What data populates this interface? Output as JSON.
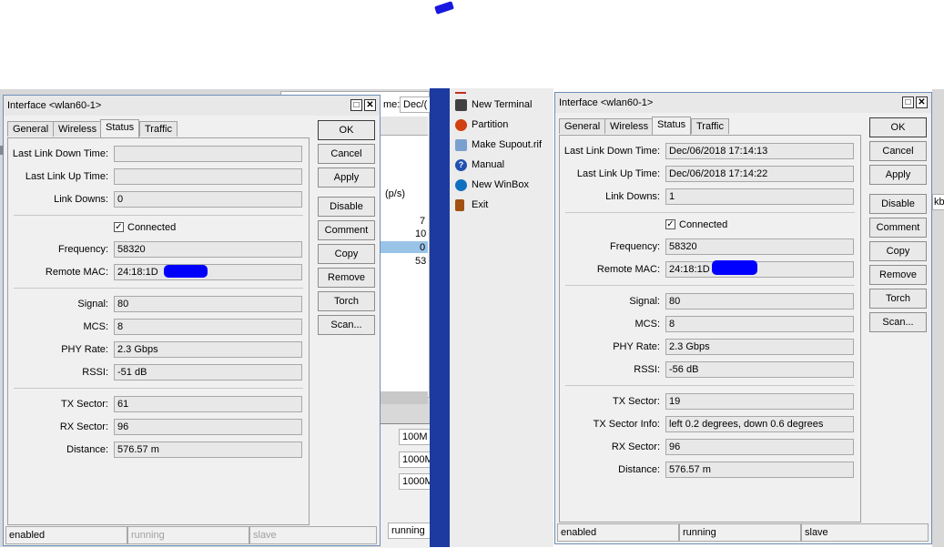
{
  "left_window": {
    "title": "Interface <wlan60-1>",
    "tabs": [
      "General",
      "Wireless",
      "Status",
      "Traffic"
    ],
    "active_tab": "Status",
    "fields": {
      "last_link_down_label": "Last Link Down Time:",
      "last_link_down": "",
      "last_link_up_label": "Last Link Up Time:",
      "last_link_up": "",
      "link_downs_label": "Link Downs:",
      "link_downs": "0",
      "connected_label": "Connected",
      "frequency_label": "Frequency:",
      "frequency": "58320",
      "remote_mac_label": "Remote MAC:",
      "remote_mac": "24:18:1D",
      "signal_label": "Signal:",
      "signal": "80",
      "mcs_label": "MCS:",
      "mcs": "8",
      "phy_rate_label": "PHY Rate:",
      "phy_rate": "2.3 Gbps",
      "rssi_label": "RSSI:",
      "rssi": "-51 dB",
      "tx_sector_label": "TX Sector:",
      "tx_sector": "61",
      "rx_sector_label": "RX Sector:",
      "rx_sector": "96",
      "distance_label": "Distance:",
      "distance": "576.57 m"
    },
    "buttons": [
      "OK",
      "Cancel",
      "Apply",
      "Disable",
      "Comment",
      "Copy",
      "Remove",
      "Torch",
      "Scan..."
    ],
    "status": [
      "enabled",
      "running",
      "slave"
    ]
  },
  "right_window": {
    "title": "Interface <wlan60-1>",
    "tabs": [
      "General",
      "Wireless",
      "Status",
      "Traffic"
    ],
    "active_tab": "Status",
    "fields": {
      "last_link_down_label": "Last Link Down Time:",
      "last_link_down": "Dec/06/2018 17:14:13",
      "last_link_up_label": "Last Link Up Time:",
      "last_link_up": "Dec/06/2018 17:14:22",
      "link_downs_label": "Link Downs:",
      "link_downs": "1",
      "connected_label": "Connected",
      "frequency_label": "Frequency:",
      "frequency": "58320",
      "remote_mac_label": "Remote MAC:",
      "remote_mac": "24:18:1D",
      "signal_label": "Signal:",
      "signal": "80",
      "mcs_label": "MCS:",
      "mcs": "8",
      "phy_rate_label": "PHY Rate:",
      "phy_rate": "2.3 Gbps",
      "rssi_label": "RSSI:",
      "rssi": "-56 dB",
      "tx_sector_label": "TX Sector:",
      "tx_sector": "19",
      "tx_sector_info_label": "TX Sector Info:",
      "tx_sector_info": "left 0.2 degrees, down 0.6 degrees",
      "rx_sector_label": "RX Sector:",
      "rx_sector": "96",
      "distance_label": "Distance:",
      "distance": "576.57 m"
    },
    "buttons": [
      "OK",
      "Cancel",
      "Apply",
      "Disable",
      "Comment",
      "Copy",
      "Remove",
      "Torch",
      "Scan..."
    ],
    "status": [
      "enabled",
      "running",
      "slave"
    ]
  },
  "menu": {
    "items": [
      {
        "label": "New Terminal",
        "icon": "terminal-icon",
        "color": "#404040"
      },
      {
        "label": "Partition",
        "icon": "partition-icon",
        "color": "#d04010"
      },
      {
        "label": "Make Supout.rif",
        "icon": "supout-icon",
        "color": "#7aa0d0"
      },
      {
        "label": "Manual",
        "icon": "help-icon",
        "color": "#2050b0"
      },
      {
        "label": "New WinBox",
        "icon": "winbox-icon",
        "color": "#1070c0"
      },
      {
        "label": "Exit",
        "icon": "exit-icon",
        "color": "#a05010"
      }
    ]
  },
  "background": {
    "me_label": "me:",
    "date_field": "Dec/(",
    "pps_header": "(p/s)",
    "numbers": [
      "7",
      "10",
      "0",
      "53"
    ],
    "speeds": [
      "100M",
      "1000M",
      "1000M"
    ],
    "running": "running",
    "kb": "kb"
  },
  "colors": {
    "redaction": "#0000ff",
    "sidebar_blue": "#1c3aa0",
    "selected_row": "#99c4e8"
  }
}
